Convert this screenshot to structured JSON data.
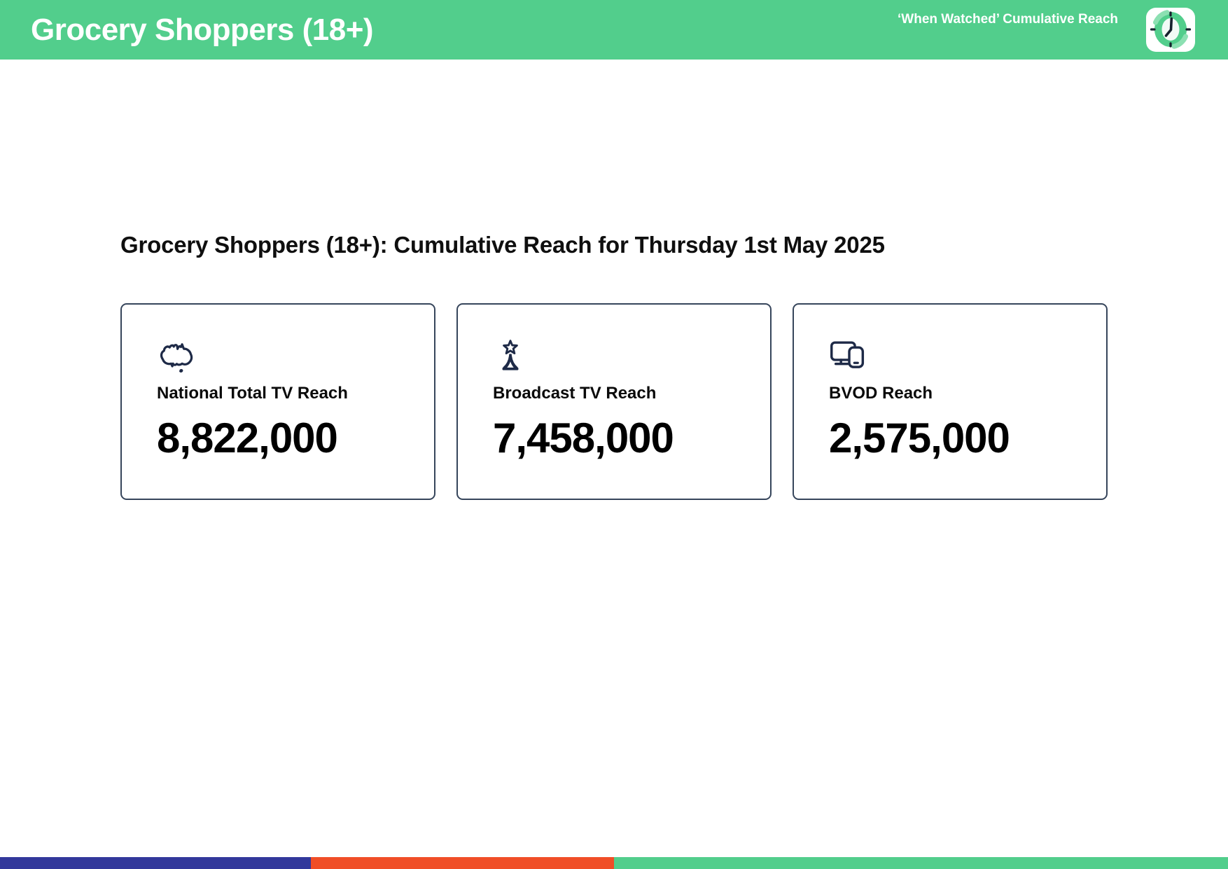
{
  "header": {
    "title": "Grocery Shoppers (18+)",
    "right_label": "‘When Watched’ Cumulative Reach",
    "bg_color": "#52CE8C",
    "clock_icon": "clock-icon"
  },
  "main": {
    "heading": "Grocery Shoppers (18+): Cumulative Reach for Thursday 1st May 2025",
    "cards": [
      {
        "icon": "australia-map-icon",
        "label": "National Total TV Reach",
        "value": "8,822,000"
      },
      {
        "icon": "broadcast-tower-icon",
        "label": "Broadcast TV Reach",
        "value": "7,458,000"
      },
      {
        "icon": "multi-device-icon",
        "label": "BVOD Reach",
        "value": "2,575,000"
      }
    ],
    "icon_color": "#1E2A47",
    "card_border_color": "#36455B"
  },
  "footer": {
    "segments": [
      {
        "name": "blue",
        "color": "#32389B"
      },
      {
        "name": "orange",
        "color": "#F04E27"
      },
      {
        "name": "green",
        "color": "#52CE8C"
      }
    ]
  }
}
